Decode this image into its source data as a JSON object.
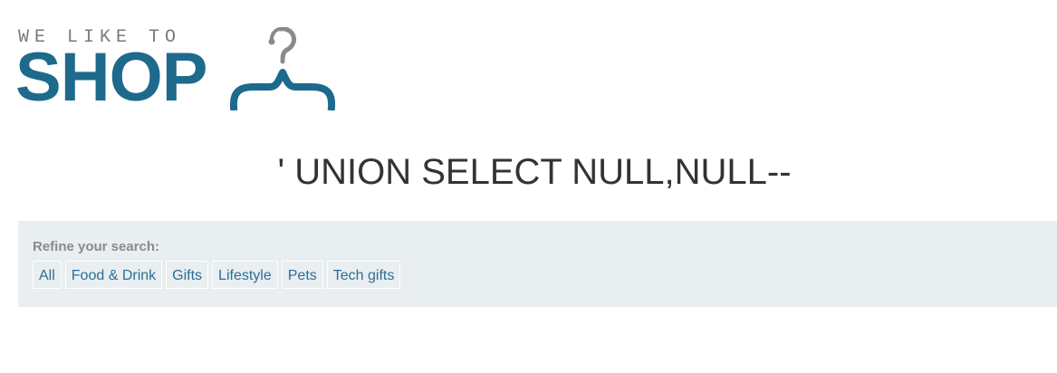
{
  "logo": {
    "tagline": "WE LIKE TO",
    "wordmark": "SHOP"
  },
  "search": {
    "heading": "' UNION SELECT NULL,NULL--"
  },
  "filters": {
    "label": "Refine your search:",
    "categories": [
      "All",
      "Food & Drink",
      "Gifts",
      "Lifestyle",
      "Pets",
      "Tech gifts"
    ]
  },
  "colors": {
    "brand": "#1e6a8d",
    "link": "#2c6e96",
    "panel_bg": "#e9eef0",
    "tagline": "#7a7a7a"
  }
}
